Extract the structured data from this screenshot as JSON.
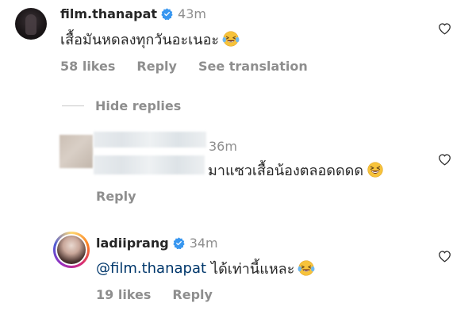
{
  "comments": [
    {
      "username": "film.thanapat",
      "time": "43m",
      "text": "เสื้อมันหดลงทุกวันอะเนอะ",
      "emoji": "laughing-tears",
      "likes": "58 likes",
      "reply": "Reply",
      "translation": "See translation",
      "verified": true
    }
  ],
  "hide_replies": "Hide replies",
  "replies": [
    {
      "username": "",
      "time": "36m",
      "text": "มาแซวเสื้อน้องตลอดดดด",
      "emoji": "grinning-squint",
      "reply": "Reply",
      "verified": false
    },
    {
      "username": "ladiiprang",
      "time": "34m",
      "mention": "@film.thanapat",
      "text": "ได้เท่านี้แหละ",
      "emoji": "laughing-tears",
      "likes": "19 likes",
      "reply": "Reply",
      "verified": true
    }
  ],
  "colors": {
    "verified_blue": "#3897f0",
    "mention_blue": "#00376b",
    "muted_gray": "#8e8e8e",
    "text": "#262626"
  }
}
